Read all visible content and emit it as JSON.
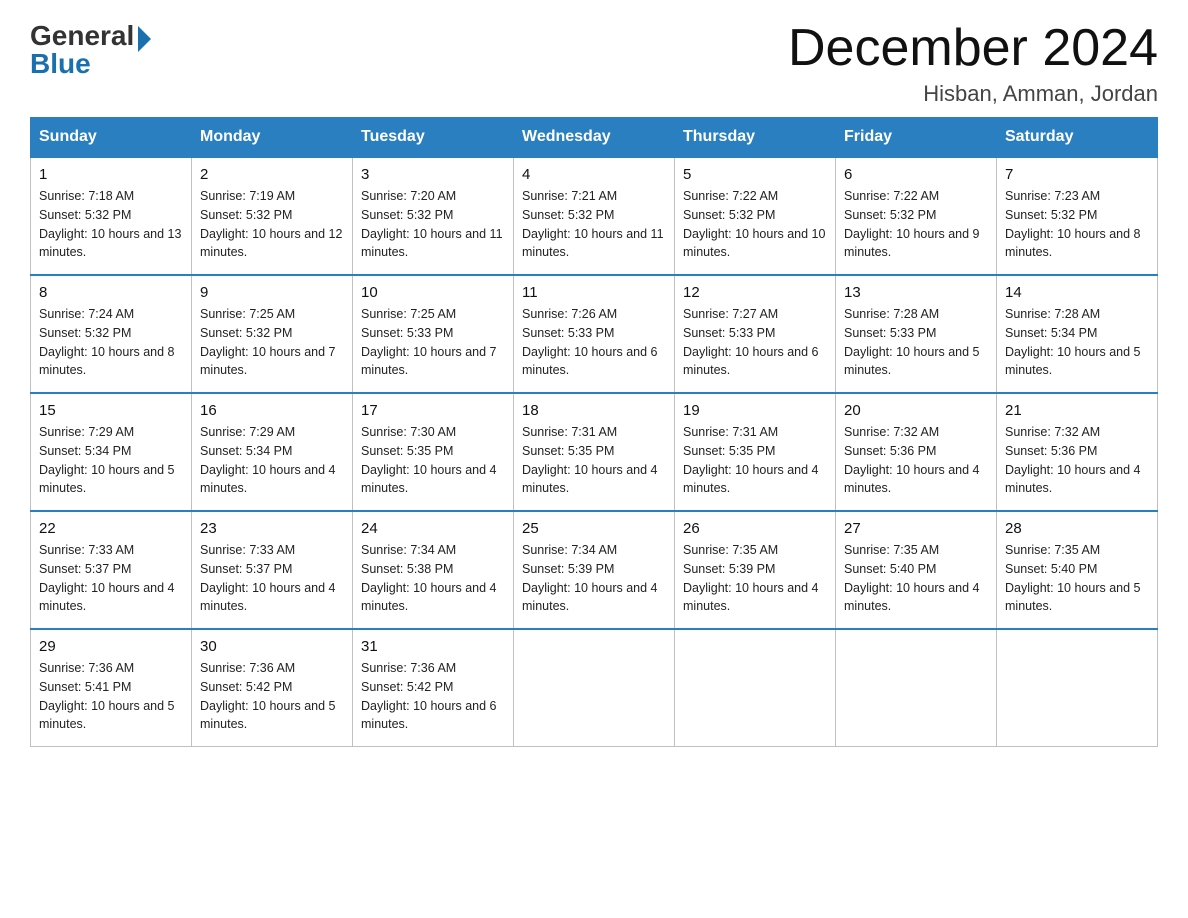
{
  "header": {
    "logo_general": "General",
    "logo_blue": "Blue",
    "title": "December 2024",
    "location": "Hisban, Amman, Jordan"
  },
  "days_of_week": [
    "Sunday",
    "Monday",
    "Tuesday",
    "Wednesday",
    "Thursday",
    "Friday",
    "Saturday"
  ],
  "weeks": [
    [
      {
        "day": "1",
        "sunrise": "7:18 AM",
        "sunset": "5:32 PM",
        "daylight": "10 hours and 13 minutes."
      },
      {
        "day": "2",
        "sunrise": "7:19 AM",
        "sunset": "5:32 PM",
        "daylight": "10 hours and 12 minutes."
      },
      {
        "day": "3",
        "sunrise": "7:20 AM",
        "sunset": "5:32 PM",
        "daylight": "10 hours and 11 minutes."
      },
      {
        "day": "4",
        "sunrise": "7:21 AM",
        "sunset": "5:32 PM",
        "daylight": "10 hours and 11 minutes."
      },
      {
        "day": "5",
        "sunrise": "7:22 AM",
        "sunset": "5:32 PM",
        "daylight": "10 hours and 10 minutes."
      },
      {
        "day": "6",
        "sunrise": "7:22 AM",
        "sunset": "5:32 PM",
        "daylight": "10 hours and 9 minutes."
      },
      {
        "day": "7",
        "sunrise": "7:23 AM",
        "sunset": "5:32 PM",
        "daylight": "10 hours and 8 minutes."
      }
    ],
    [
      {
        "day": "8",
        "sunrise": "7:24 AM",
        "sunset": "5:32 PM",
        "daylight": "10 hours and 8 minutes."
      },
      {
        "day": "9",
        "sunrise": "7:25 AM",
        "sunset": "5:32 PM",
        "daylight": "10 hours and 7 minutes."
      },
      {
        "day": "10",
        "sunrise": "7:25 AM",
        "sunset": "5:33 PM",
        "daylight": "10 hours and 7 minutes."
      },
      {
        "day": "11",
        "sunrise": "7:26 AM",
        "sunset": "5:33 PM",
        "daylight": "10 hours and 6 minutes."
      },
      {
        "day": "12",
        "sunrise": "7:27 AM",
        "sunset": "5:33 PM",
        "daylight": "10 hours and 6 minutes."
      },
      {
        "day": "13",
        "sunrise": "7:28 AM",
        "sunset": "5:33 PM",
        "daylight": "10 hours and 5 minutes."
      },
      {
        "day": "14",
        "sunrise": "7:28 AM",
        "sunset": "5:34 PM",
        "daylight": "10 hours and 5 minutes."
      }
    ],
    [
      {
        "day": "15",
        "sunrise": "7:29 AM",
        "sunset": "5:34 PM",
        "daylight": "10 hours and 5 minutes."
      },
      {
        "day": "16",
        "sunrise": "7:29 AM",
        "sunset": "5:34 PM",
        "daylight": "10 hours and 4 minutes."
      },
      {
        "day": "17",
        "sunrise": "7:30 AM",
        "sunset": "5:35 PM",
        "daylight": "10 hours and 4 minutes."
      },
      {
        "day": "18",
        "sunrise": "7:31 AM",
        "sunset": "5:35 PM",
        "daylight": "10 hours and 4 minutes."
      },
      {
        "day": "19",
        "sunrise": "7:31 AM",
        "sunset": "5:35 PM",
        "daylight": "10 hours and 4 minutes."
      },
      {
        "day": "20",
        "sunrise": "7:32 AM",
        "sunset": "5:36 PM",
        "daylight": "10 hours and 4 minutes."
      },
      {
        "day": "21",
        "sunrise": "7:32 AM",
        "sunset": "5:36 PM",
        "daylight": "10 hours and 4 minutes."
      }
    ],
    [
      {
        "day": "22",
        "sunrise": "7:33 AM",
        "sunset": "5:37 PM",
        "daylight": "10 hours and 4 minutes."
      },
      {
        "day": "23",
        "sunrise": "7:33 AM",
        "sunset": "5:37 PM",
        "daylight": "10 hours and 4 minutes."
      },
      {
        "day": "24",
        "sunrise": "7:34 AM",
        "sunset": "5:38 PM",
        "daylight": "10 hours and 4 minutes."
      },
      {
        "day": "25",
        "sunrise": "7:34 AM",
        "sunset": "5:39 PM",
        "daylight": "10 hours and 4 minutes."
      },
      {
        "day": "26",
        "sunrise": "7:35 AM",
        "sunset": "5:39 PM",
        "daylight": "10 hours and 4 minutes."
      },
      {
        "day": "27",
        "sunrise": "7:35 AM",
        "sunset": "5:40 PM",
        "daylight": "10 hours and 4 minutes."
      },
      {
        "day": "28",
        "sunrise": "7:35 AM",
        "sunset": "5:40 PM",
        "daylight": "10 hours and 5 minutes."
      }
    ],
    [
      {
        "day": "29",
        "sunrise": "7:36 AM",
        "sunset": "5:41 PM",
        "daylight": "10 hours and 5 minutes."
      },
      {
        "day": "30",
        "sunrise": "7:36 AM",
        "sunset": "5:42 PM",
        "daylight": "10 hours and 5 minutes."
      },
      {
        "day": "31",
        "sunrise": "7:36 AM",
        "sunset": "5:42 PM",
        "daylight": "10 hours and 6 minutes."
      },
      null,
      null,
      null,
      null
    ]
  ],
  "labels": {
    "sunrise": "Sunrise:",
    "sunset": "Sunset:",
    "daylight": "Daylight:"
  }
}
